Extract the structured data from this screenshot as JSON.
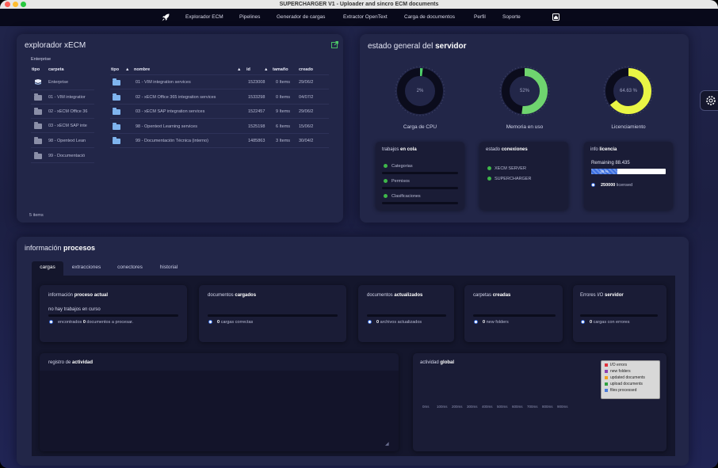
{
  "window": {
    "title": "SUPERCHARGER V1 - Uploader and sincro ECM documents"
  },
  "nav": {
    "items": [
      "Explorador ECM",
      "Pipelines",
      "Generador de cargas",
      "Extractor OpenText",
      "Carga de documentos",
      "Perfil",
      "Soporte"
    ],
    "logo_icon": "rocket-icon",
    "home_icon": "home-icon"
  },
  "explorer": {
    "title": "explorador xECM",
    "breadcrumb": "Enterprise",
    "left_headers": {
      "tipo": "tipo",
      "carpeta": "carpeta"
    },
    "tree": [
      {
        "name": "Enterprise",
        "icon": "stack-icon"
      },
      {
        "name": "01 - VIM integratior",
        "icon": "folder-icon"
      },
      {
        "name": "02 - xECM Office 36",
        "icon": "folder-icon"
      },
      {
        "name": "03 - xECM SAP inte",
        "icon": "folder-icon"
      },
      {
        "name": "98 - Opentext Lean",
        "icon": "folder-icon"
      },
      {
        "name": "99 - Documentació",
        "icon": "folder-icon"
      }
    ],
    "table_headers": {
      "tipo": "tipo",
      "nombre": "nombre",
      "id": "id",
      "tamano": "tamaño",
      "creado": "creado"
    },
    "rows": [
      {
        "nombre": "01 - VIM integration services",
        "id": "1523008",
        "tamano": "0 Items",
        "creado": "29/06/2"
      },
      {
        "nombre": "02 - xECM Office 365 integration services",
        "id": "1533298",
        "tamano": "0 Items",
        "creado": "04/07/2"
      },
      {
        "nombre": "03 - xECM SAP integration services",
        "id": "1522457",
        "tamano": "9 Items",
        "creado": "29/06/2"
      },
      {
        "nombre": "98 - Opentext Learning services",
        "id": "1525198",
        "tamano": "6 Items",
        "creado": "15/06/2"
      },
      {
        "nombre": "99 - Documentación Técnica (interno)",
        "id": "1485863",
        "tamano": "3 Items",
        "creado": "30/04/2"
      }
    ],
    "footer": "5 items"
  },
  "server": {
    "title_prefix": "estado general del ",
    "title_bold": "servidor",
    "gauges": [
      {
        "label": "Carga de CPU",
        "value": "2%",
        "fraction": 0.02,
        "color": "#4fd06a"
      },
      {
        "label": "Memoria en uso",
        "value": "52%",
        "fraction": 0.52,
        "color": "#6fd46f"
      },
      {
        "label": "Licenciamiento",
        "value": "64.63 %",
        "fraction": 0.6463,
        "color": "#e9f545"
      }
    ],
    "queue": {
      "title_prefix": "trabajos ",
      "title_bold": "en cola",
      "items": [
        "Categorias",
        "Permisos",
        "Clasificaciones"
      ]
    },
    "connections": {
      "title_prefix": "estado ",
      "title_bold": "conexiones",
      "items": [
        "XECM SERVER",
        "SUPERCHARGER"
      ]
    },
    "license": {
      "title_prefix": "info ",
      "title_bold": "licencia",
      "remaining": "Remaining 88.435",
      "bar_label": "35 %",
      "bar_fraction": 0.35,
      "licensed_count": "250000",
      "licensed_label": "licensed"
    }
  },
  "processes": {
    "title_prefix": "información ",
    "title_bold": "procesos",
    "tabs": [
      "cargas",
      "extracciones",
      "conectores",
      "historial"
    ],
    "current": {
      "title_prefix": "información ",
      "title_bold": "proceso actual",
      "status": "no hay trabajos en curso",
      "found_prefix": "encontrados ",
      "found_count": "0",
      "found_suffix": " documentos a procesar."
    },
    "stats": [
      {
        "title_prefix": "documentos ",
        "title_bold": "cargados",
        "count": "0",
        "label": "cargas correctas"
      },
      {
        "title_prefix": "documentos ",
        "title_bold": "actualizados",
        "count": "0",
        "label": "archivos actualizados"
      },
      {
        "title_prefix": "carpetas ",
        "title_bold": "creadas",
        "count": "0",
        "label": "new folders"
      },
      {
        "title_prefix": "Errores I/O ",
        "title_bold": "servidor",
        "count": "0",
        "label": "cargas con errores"
      }
    ],
    "activity_log": {
      "title_prefix": "registro de ",
      "title_bold": "actividad"
    },
    "global_activity": {
      "title_prefix": "actividad ",
      "title_bold": "global",
      "legend": [
        {
          "label": "I/O errors",
          "color": "#e0303a"
        },
        {
          "label": "new folders",
          "color": "#8e3fb0"
        },
        {
          "label": "updated documents",
          "color": "#f0a020"
        },
        {
          "label": "upload documents",
          "color": "#30a040"
        },
        {
          "label": "files processed",
          "color": "#4a7ad8"
        }
      ],
      "x_ticks": [
        "0ms",
        "100ms",
        "200ms",
        "300ms",
        "400ms",
        "500ms",
        "600ms",
        "700ms",
        "800ms",
        "900ms"
      ]
    }
  }
}
